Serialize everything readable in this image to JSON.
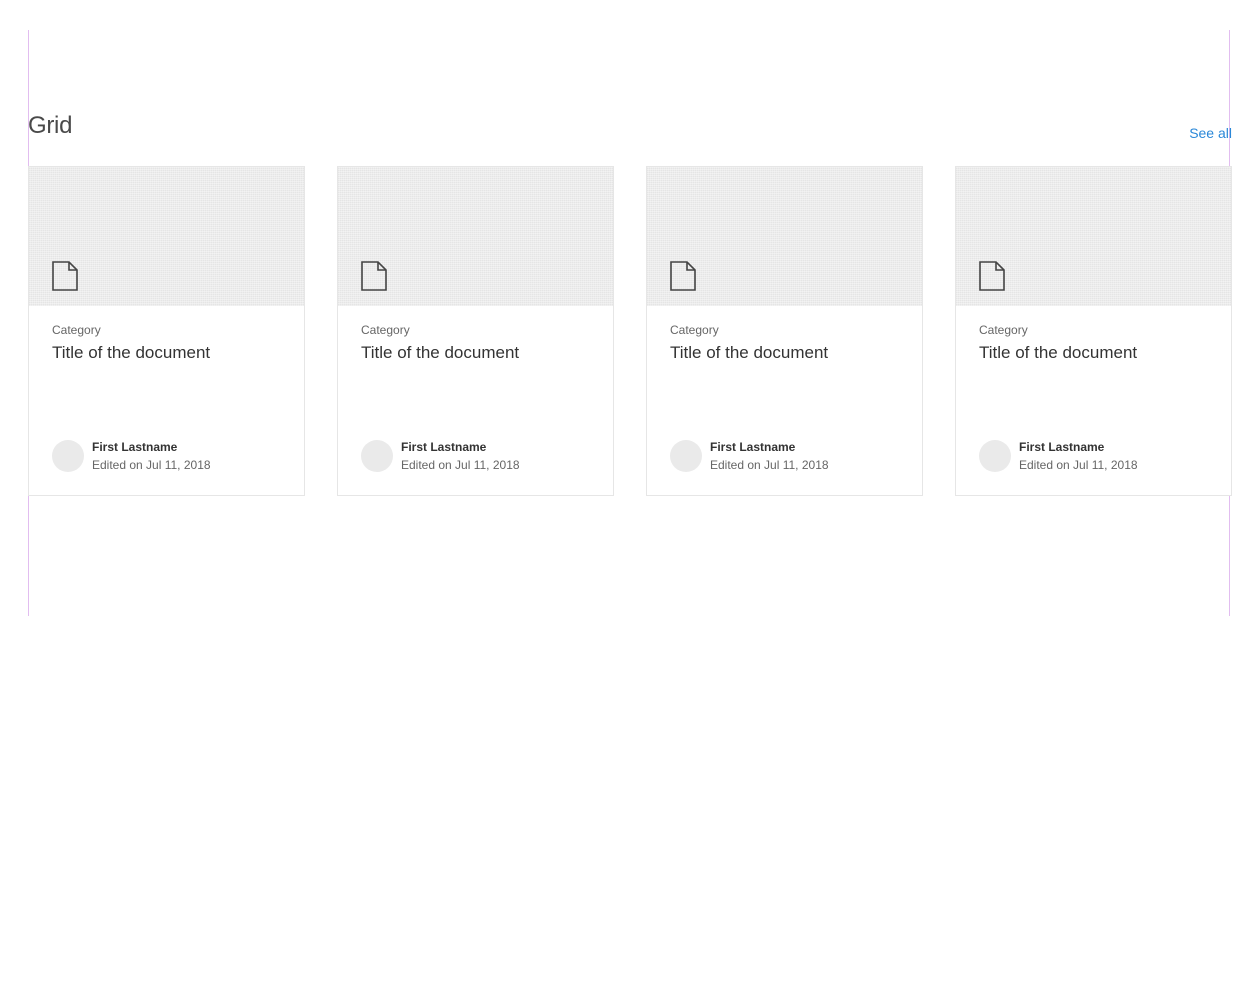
{
  "section": {
    "title": "Grid",
    "see_all_label": "See all"
  },
  "cards": [
    {
      "category": "Category",
      "title": "Title of the document",
      "author": "First Lastname",
      "edited": "Edited on Jul 11, 2018",
      "icon": "document-icon"
    },
    {
      "category": "Category",
      "title": "Title of the document",
      "author": "First Lastname",
      "edited": "Edited on Jul 11, 2018",
      "icon": "document-icon"
    },
    {
      "category": "Category",
      "title": "Title of the document",
      "author": "First Lastname",
      "edited": "Edited on Jul 11, 2018",
      "icon": "document-icon"
    },
    {
      "category": "Category",
      "title": "Title of the document",
      "author": "First Lastname",
      "edited": "Edited on Jul 11, 2018",
      "icon": "document-icon"
    }
  ],
  "colors": {
    "accent": "#2b88d8",
    "preview_bg": "#ececec",
    "guide": "#e2bdf0"
  }
}
